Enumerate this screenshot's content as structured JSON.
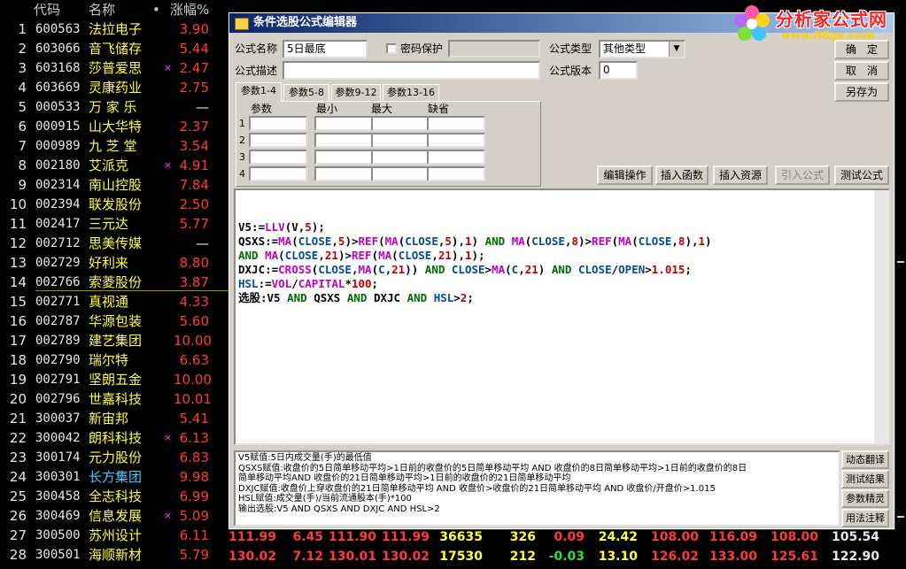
{
  "stock_list": {
    "headers": {
      "code": "代码",
      "name": "名称",
      "dot": "•",
      "pct": "涨幅%"
    },
    "rows": [
      {
        "idx": "1",
        "code": "600563",
        "name": "法拉电子",
        "mark": "",
        "pct": "3.90"
      },
      {
        "idx": "2",
        "code": "603066",
        "name": "音飞储存",
        "mark": "",
        "pct": "5.44"
      },
      {
        "idx": "3",
        "code": "603168",
        "name": "莎普爱思",
        "mark": "×",
        "pct": "2.47"
      },
      {
        "idx": "4",
        "code": "603669",
        "name": "灵康药业",
        "mark": "",
        "pct": "2.75"
      },
      {
        "idx": "5",
        "code": "000533",
        "name": "万 家 乐",
        "mark": "",
        "pct": "—"
      },
      {
        "idx": "6",
        "code": "000915",
        "name": "山大华特",
        "mark": "",
        "pct": "2.37"
      },
      {
        "idx": "7",
        "code": "000989",
        "name": "九 芝 堂",
        "mark": "",
        "pct": "3.54"
      },
      {
        "idx": "8",
        "code": "002180",
        "name": "艾派克",
        "mark": "×",
        "pct": "4.91"
      },
      {
        "idx": "9",
        "code": "002314",
        "name": "南山控股",
        "mark": "",
        "pct": "7.84"
      },
      {
        "idx": "10",
        "code": "002394",
        "name": "联发股份",
        "mark": "",
        "pct": "2.50"
      },
      {
        "idx": "11",
        "code": "002417",
        "name": "三元达",
        "mark": "",
        "pct": "5.77"
      },
      {
        "idx": "12",
        "code": "002712",
        "name": "思美传媒",
        "mark": "",
        "pct": "—"
      },
      {
        "idx": "13",
        "code": "002729",
        "name": "好利来",
        "mark": "",
        "pct": "8.80"
      },
      {
        "idx": "14",
        "code": "002766",
        "name": "索菱股份",
        "mark": "",
        "pct": "3.87"
      },
      {
        "idx": "15",
        "code": "002771",
        "name": "真视通",
        "mark": "",
        "pct": "4.33"
      },
      {
        "idx": "16",
        "code": "002787",
        "name": "华源包装",
        "mark": "",
        "pct": "5.60"
      },
      {
        "idx": "17",
        "code": "002789",
        "name": "建艺集团",
        "mark": "",
        "pct": "10.00"
      },
      {
        "idx": "18",
        "code": "002790",
        "name": "瑞尔特",
        "mark": "",
        "pct": "6.63"
      },
      {
        "idx": "19",
        "code": "002791",
        "name": "坚朗五金",
        "mark": "",
        "pct": "10.00"
      },
      {
        "idx": "20",
        "code": "002796",
        "name": "世嘉科技",
        "mark": "",
        "pct": "10.01"
      },
      {
        "idx": "21",
        "code": "300037",
        "name": "新宙邦",
        "mark": "",
        "pct": "5.41"
      },
      {
        "idx": "22",
        "code": "300042",
        "name": "朗科科技",
        "mark": "×",
        "pct": "6.13"
      },
      {
        "idx": "23",
        "code": "300174",
        "name": "元力股份",
        "mark": "",
        "pct": "6.83"
      },
      {
        "idx": "24",
        "code": "300301",
        "name": "长方集团",
        "mark": "",
        "pct": "9.98"
      },
      {
        "idx": "25",
        "code": "300458",
        "name": "全志科技",
        "mark": "",
        "pct": "6.99"
      },
      {
        "idx": "26",
        "code": "300469",
        "name": "信息发展",
        "mark": "×",
        "pct": "5.09"
      },
      {
        "idx": "27",
        "code": "300500",
        "name": "苏州设计",
        "mark": "",
        "pct": "6.11"
      },
      {
        "idx": "28",
        "code": "300501",
        "name": "海顺新材",
        "mark": "",
        "pct": "5.79"
      }
    ],
    "bottom_rows": [
      [
        "111.99",
        "6.45",
        "111.90",
        "111.99",
        "36635",
        "326",
        "0.09",
        "24.42",
        "108.00",
        "116.09",
        "108.00",
        "105.54"
      ],
      [
        "130.02",
        "7.12",
        "130.01",
        "130.02",
        "17530",
        "212",
        "-0.03",
        "13.10",
        "126.02",
        "133.00",
        "125.61",
        "122.90"
      ]
    ]
  },
  "logo": {
    "title": "分析家公式网",
    "url": "www.88gs.com"
  },
  "dialog": {
    "title": "条件选股公式编辑器",
    "name_label": "公式名称",
    "name_value": "5日最底",
    "password_label": "密码保护",
    "desc_label": "公式描述",
    "desc_value": "",
    "type_label": "公式类型",
    "type_value": "其他类型",
    "version_label": "公式版本",
    "version_value": "0",
    "ok_button": "确　定",
    "cancel_button": "取　消",
    "save_as_button": "另存为",
    "tabs": [
      "参数1-4",
      "参数5-8",
      "参数9-12",
      "参数13-16"
    ],
    "param_headers": [
      "参数",
      "最小",
      "最大",
      "缺省"
    ],
    "param_rows": [
      "1",
      "2",
      "3",
      "4"
    ],
    "buttons": [
      "编辑操作",
      "插入函数",
      "插入资源",
      "引入公式",
      "测试公式"
    ],
    "code_lines": [
      [
        [
          "V5:=",
          "def"
        ],
        [
          "LLV",
          "fn"
        ],
        [
          "(",
          "def"
        ],
        [
          "V",
          "def"
        ],
        [
          ",",
          "def"
        ],
        [
          "5",
          "num"
        ],
        [
          ");",
          "def"
        ]
      ],
      [
        [
          "QSXS:=",
          "def"
        ],
        [
          "MA",
          "fn"
        ],
        [
          "(",
          "def"
        ],
        [
          "CLOSE",
          "id"
        ],
        [
          ",",
          "def"
        ],
        [
          "5",
          "num"
        ],
        [
          ")>",
          "def"
        ],
        [
          "REF",
          "fn"
        ],
        [
          "(",
          "def"
        ],
        [
          "MA",
          "fn"
        ],
        [
          "(",
          "def"
        ],
        [
          "CLOSE",
          "id"
        ],
        [
          ",",
          "def"
        ],
        [
          "5",
          "num"
        ],
        [
          "),",
          "def"
        ],
        [
          "1",
          "num"
        ],
        [
          ") ",
          "def"
        ],
        [
          "AND",
          "kw"
        ],
        [
          " ",
          "def"
        ],
        [
          "MA",
          "fn"
        ],
        [
          "(",
          "def"
        ],
        [
          "CLOSE",
          "id"
        ],
        [
          ",",
          "def"
        ],
        [
          "8",
          "num"
        ],
        [
          ")>",
          "def"
        ],
        [
          "REF",
          "fn"
        ],
        [
          "(",
          "def"
        ],
        [
          "MA",
          "fn"
        ],
        [
          "(",
          "def"
        ],
        [
          "CLOSE",
          "id"
        ],
        [
          ",",
          "def"
        ],
        [
          "8",
          "num"
        ],
        [
          "),",
          "def"
        ],
        [
          "1",
          "num"
        ],
        [
          ")",
          "def"
        ]
      ],
      [
        [
          "AND",
          "kw"
        ],
        [
          " ",
          "def"
        ],
        [
          "MA",
          "fn"
        ],
        [
          "(",
          "def"
        ],
        [
          "CLOSE",
          "id"
        ],
        [
          ",",
          "def"
        ],
        [
          "21",
          "num"
        ],
        [
          ")>",
          "def"
        ],
        [
          "REF",
          "fn"
        ],
        [
          "(",
          "def"
        ],
        [
          "MA",
          "fn"
        ],
        [
          "(",
          "def"
        ],
        [
          "CLOSE",
          "id"
        ],
        [
          ",",
          "def"
        ],
        [
          "21",
          "num"
        ],
        [
          "),",
          "def"
        ],
        [
          "1",
          "num"
        ],
        [
          ");",
          "def"
        ]
      ],
      [
        [
          "DXJC:=",
          "def"
        ],
        [
          "CROSS",
          "fn"
        ],
        [
          "(",
          "def"
        ],
        [
          "CLOSE",
          "id"
        ],
        [
          ",",
          "def"
        ],
        [
          "MA",
          "fn"
        ],
        [
          "(",
          "def"
        ],
        [
          "C",
          "id"
        ],
        [
          ",",
          "def"
        ],
        [
          "21",
          "num"
        ],
        [
          ")) ",
          "def"
        ],
        [
          "AND",
          "kw"
        ],
        [
          " ",
          "def"
        ],
        [
          "CLOSE",
          "id"
        ],
        [
          ">",
          "def"
        ],
        [
          "MA",
          "fn"
        ],
        [
          "(",
          "def"
        ],
        [
          "C",
          "id"
        ],
        [
          ",",
          "def"
        ],
        [
          "21",
          "num"
        ],
        [
          ") ",
          "def"
        ],
        [
          "AND",
          "kw"
        ],
        [
          " ",
          "def"
        ],
        [
          "CLOSE",
          "id"
        ],
        [
          "/",
          "def"
        ],
        [
          "OPEN",
          "id"
        ],
        [
          ">",
          "def"
        ],
        [
          "1.015",
          "num"
        ],
        [
          ";",
          "def"
        ]
      ],
      [
        [
          "HSL",
          "id"
        ],
        [
          ":=",
          "def"
        ],
        [
          "VOL",
          "fn"
        ],
        [
          "/",
          "def"
        ],
        [
          "CAPITAL",
          "fn"
        ],
        [
          "*",
          "def"
        ],
        [
          "100",
          "num"
        ],
        [
          ";",
          "def"
        ]
      ],
      [
        [
          "选股:V5 ",
          "def"
        ],
        [
          "AND",
          "kw"
        ],
        [
          " QSXS ",
          "def"
        ],
        [
          "AND",
          "kw"
        ],
        [
          " DXJC ",
          "def"
        ],
        [
          "AND",
          "kw"
        ],
        [
          " ",
          "def"
        ],
        [
          "HSL",
          "id"
        ],
        [
          ">",
          "def"
        ],
        [
          "2",
          "num"
        ],
        [
          ";",
          "def"
        ]
      ]
    ],
    "desc_lines": [
      "V5赋值:5日内成交量(手)的最低值",
      "QSXS赋值:收盘价的5日简单移动平均>1日前的收盘价的5日简单移动平均 AND 收盘价的8日简单移动平均>1日前的收盘价的8日",
      "简单移动平均AND 收盘价的21日简单移动平均>1日前的收盘价的21日简单移动平均",
      "DXJC赋值:收盘价上穿收盘价的21日简单移动平均 AND 收盘价>收盘价的21日简单移动平均 AND 收盘价/开盘价>1.015",
      "HSL赋值:成交量(手)/当前流通股本(手)*100",
      "输出选股:V5 AND QSXS AND DXJC AND HSL>2"
    ],
    "side_buttons": [
      "动态翻译",
      "测试结果",
      "参数精灵",
      "用法注释"
    ]
  }
}
